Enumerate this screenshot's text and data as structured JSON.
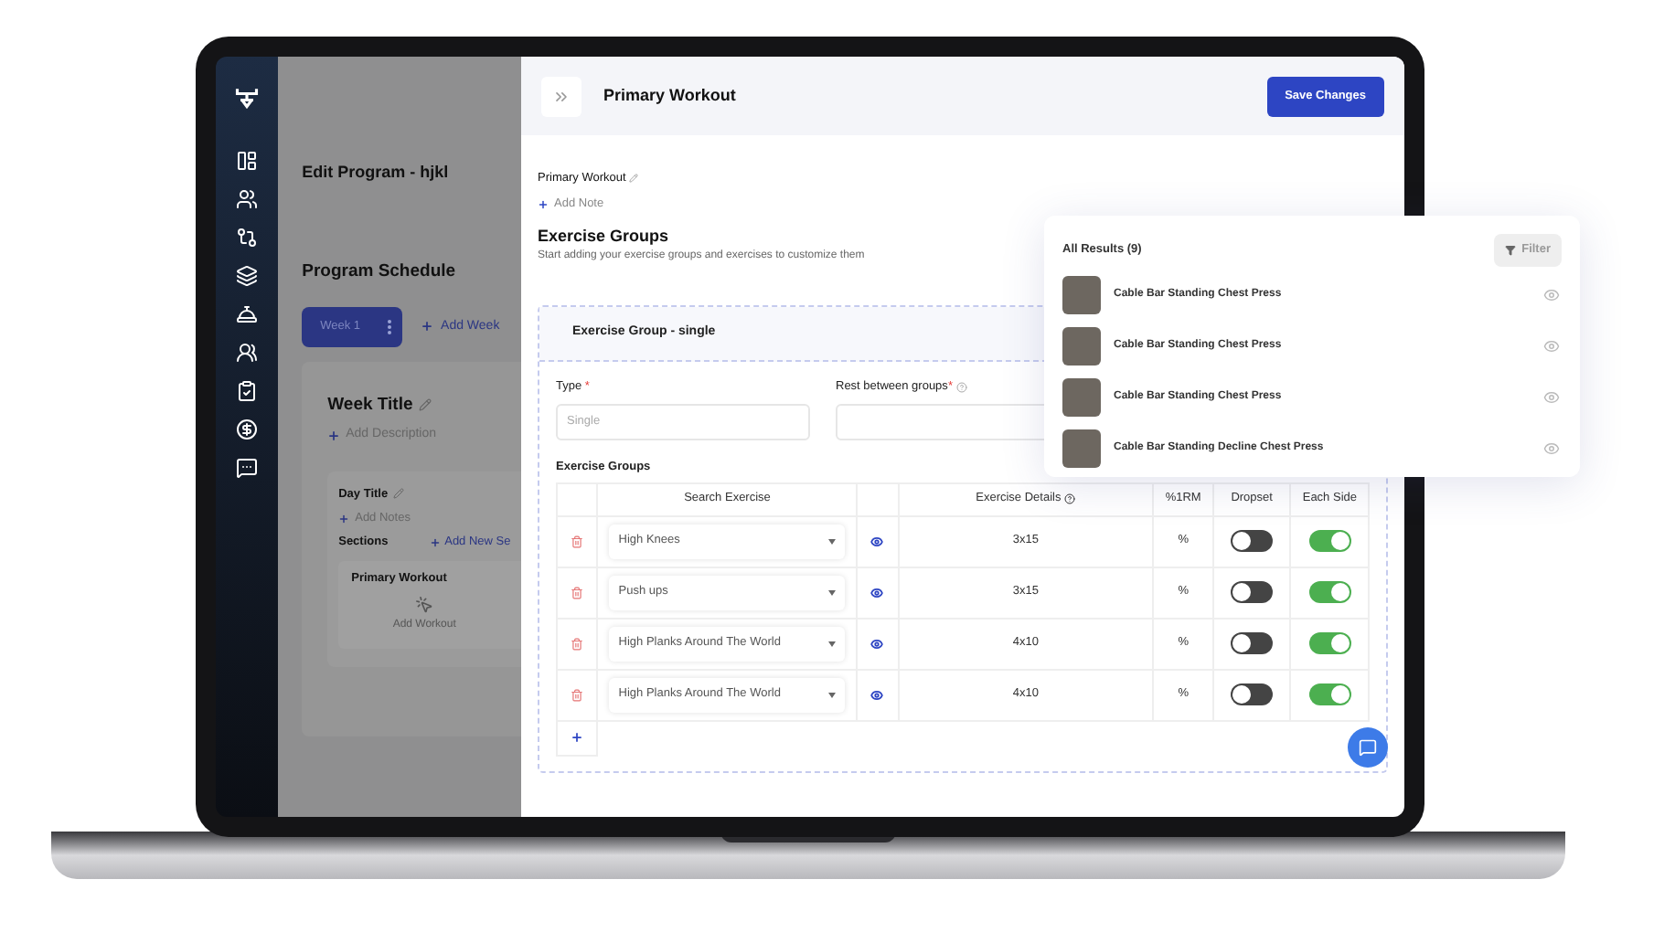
{
  "background_page": {
    "title": "Edit Program - hjkl",
    "schedule_title": "Program Schedule",
    "weeks": [
      {
        "label": "Week 1",
        "selected": true
      }
    ],
    "add_week": "Add Week",
    "week_title": "Week Title",
    "add_description": "Add Description",
    "day_title": "Day Title",
    "add_notes": "Add Notes",
    "sections_label": "Sections",
    "add_section": "Add New Se",
    "section_card": {
      "title": "Primary Workout",
      "action": "Add Workout"
    }
  },
  "drawer": {
    "title": "Primary Workout",
    "save_button": "Save Changes",
    "workout_name": "Primary Workout",
    "add_note": "Add Note",
    "heading": "Exercise Groups",
    "subheading": "Start adding your exercise groups and exercises to customize them",
    "group": {
      "title": "Exercise Group - single",
      "type_label": "Type",
      "rest_label": "Rest between groups",
      "required_mark": "*",
      "type_placeholder": "Single",
      "section_label": "Exercise Groups",
      "columns": [
        "Search Exercise",
        "Exercise Details",
        "%1RM",
        "Dropset",
        "Each Side"
      ],
      "rows": [
        {
          "exercise": "High Knees",
          "details": "3x15",
          "rm": "%",
          "dropset": false,
          "each_side": true
        },
        {
          "exercise": "Push ups",
          "details": "3x15",
          "rm": "%",
          "dropset": false,
          "each_side": true
        },
        {
          "exercise": "High Planks Around The World",
          "details": "4x10",
          "rm": "%",
          "dropset": false,
          "each_side": true
        },
        {
          "exercise": "High Planks Around The World",
          "details": "4x10",
          "rm": "%",
          "dropset": false,
          "each_side": true
        }
      ]
    }
  },
  "results_popup": {
    "title": "All Results (9)",
    "filter": "Filter",
    "items": [
      {
        "name": "Cable Bar Standing Chest Press"
      },
      {
        "name": "Cable Bar Standing Chest Press"
      },
      {
        "name": "Cable Bar Standing Chest Press"
      },
      {
        "name": "Cable Bar Standing Decline Chest Press"
      }
    ]
  }
}
